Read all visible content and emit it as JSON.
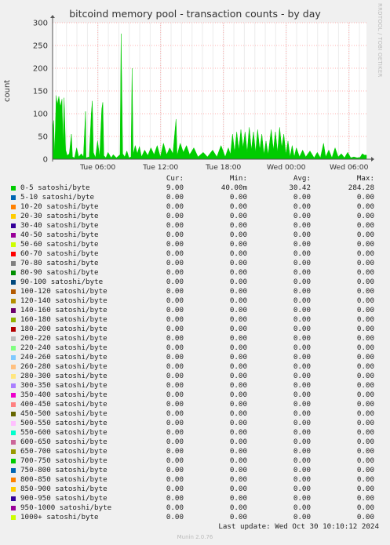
{
  "title": "bitcoind memory pool - transaction counts - by day",
  "side_label": "RRDTOOL / TOBI OETIKER",
  "footer": {
    "last_update": "Last update: Wed Oct 30 10:10:12 2024",
    "version": "Munin 2.0.76"
  },
  "colors": {
    "background": "#f0f0f0",
    "plot_background": "#ffffff",
    "grid": "#ff9999",
    "series_fill": "#00cc00"
  },
  "legend_headers": {
    "cur": "Cur:",
    "min": "Min:",
    "avg": "Avg:",
    "max": "Max:"
  },
  "legend": [
    {
      "name": "0-5 satoshi/byte",
      "color": "#00cc00",
      "cur": "9.00",
      "min": "40.00m",
      "avg": "30.42",
      "max": "284.28"
    },
    {
      "name": "5-10 satoshi/byte",
      "color": "#0066b3",
      "cur": "0.00",
      "min": "0.00",
      "avg": "0.00",
      "max": "0.00"
    },
    {
      "name": "10-20 satoshi/byte",
      "color": "#ff8000",
      "cur": "0.00",
      "min": "0.00",
      "avg": "0.00",
      "max": "0.00"
    },
    {
      "name": "20-30 satoshi/byte",
      "color": "#ffcc00",
      "cur": "0.00",
      "min": "0.00",
      "avg": "0.00",
      "max": "0.00"
    },
    {
      "name": "30-40 satoshi/byte",
      "color": "#330099",
      "cur": "0.00",
      "min": "0.00",
      "avg": "0.00",
      "max": "0.00"
    },
    {
      "name": "40-50 satoshi/byte",
      "color": "#990099",
      "cur": "0.00",
      "min": "0.00",
      "avg": "0.00",
      "max": "0.00"
    },
    {
      "name": "50-60 satoshi/byte",
      "color": "#ccff00",
      "cur": "0.00",
      "min": "0.00",
      "avg": "0.00",
      "max": "0.00"
    },
    {
      "name": "60-70 satoshi/byte",
      "color": "#ff0000",
      "cur": "0.00",
      "min": "0.00",
      "avg": "0.00",
      "max": "0.00"
    },
    {
      "name": "70-80 satoshi/byte",
      "color": "#808080",
      "cur": "0.00",
      "min": "0.00",
      "avg": "0.00",
      "max": "0.00"
    },
    {
      "name": "80-90 satoshi/byte",
      "color": "#008f00",
      "cur": "0.00",
      "min": "0.00",
      "avg": "0.00",
      "max": "0.00"
    },
    {
      "name": "90-100 satoshi/byte",
      "color": "#00487d",
      "cur": "0.00",
      "min": "0.00",
      "avg": "0.00",
      "max": "0.00"
    },
    {
      "name": "100-120 satoshi/byte",
      "color": "#b35a00",
      "cur": "0.00",
      "min": "0.00",
      "avg": "0.00",
      "max": "0.00"
    },
    {
      "name": "120-140 satoshi/byte",
      "color": "#b38f00",
      "cur": "0.00",
      "min": "0.00",
      "avg": "0.00",
      "max": "0.00"
    },
    {
      "name": "140-160 satoshi/byte",
      "color": "#6b006b",
      "cur": "0.00",
      "min": "0.00",
      "avg": "0.00",
      "max": "0.00"
    },
    {
      "name": "160-180 satoshi/byte",
      "color": "#8fb300",
      "cur": "0.00",
      "min": "0.00",
      "avg": "0.00",
      "max": "0.00"
    },
    {
      "name": "180-200 satoshi/byte",
      "color": "#b30000",
      "cur": "0.00",
      "min": "0.00",
      "avg": "0.00",
      "max": "0.00"
    },
    {
      "name": "200-220 satoshi/byte",
      "color": "#bebebe",
      "cur": "0.00",
      "min": "0.00",
      "avg": "0.00",
      "max": "0.00"
    },
    {
      "name": "220-240 satoshi/byte",
      "color": "#80ff80",
      "cur": "0.00",
      "min": "0.00",
      "avg": "0.00",
      "max": "0.00"
    },
    {
      "name": "240-260 satoshi/byte",
      "color": "#80c9ff",
      "cur": "0.00",
      "min": "0.00",
      "avg": "0.00",
      "max": "0.00"
    },
    {
      "name": "260-280 satoshi/byte",
      "color": "#ffc080",
      "cur": "0.00",
      "min": "0.00",
      "avg": "0.00",
      "max": "0.00"
    },
    {
      "name": "280-300 satoshi/byte",
      "color": "#ffe680",
      "cur": "0.00",
      "min": "0.00",
      "avg": "0.00",
      "max": "0.00"
    },
    {
      "name": "300-350 satoshi/byte",
      "color": "#aa80ff",
      "cur": "0.00",
      "min": "0.00",
      "avg": "0.00",
      "max": "0.00"
    },
    {
      "name": "350-400 satoshi/byte",
      "color": "#ee00cc",
      "cur": "0.00",
      "min": "0.00",
      "avg": "0.00",
      "max": "0.00"
    },
    {
      "name": "400-450 satoshi/byte",
      "color": "#ff8080",
      "cur": "0.00",
      "min": "0.00",
      "avg": "0.00",
      "max": "0.00"
    },
    {
      "name": "450-500 satoshi/byte",
      "color": "#666600",
      "cur": "0.00",
      "min": "0.00",
      "avg": "0.00",
      "max": "0.00"
    },
    {
      "name": "500-550 satoshi/byte",
      "color": "#ffbfff",
      "cur": "0.00",
      "min": "0.00",
      "avg": "0.00",
      "max": "0.00"
    },
    {
      "name": "550-600 satoshi/byte",
      "color": "#00ffcc",
      "cur": "0.00",
      "min": "0.00",
      "avg": "0.00",
      "max": "0.00"
    },
    {
      "name": "600-650 satoshi/byte",
      "color": "#cc6699",
      "cur": "0.00",
      "min": "0.00",
      "avg": "0.00",
      "max": "0.00"
    },
    {
      "name": "650-700 satoshi/byte",
      "color": "#999900",
      "cur": "0.00",
      "min": "0.00",
      "avg": "0.00",
      "max": "0.00"
    },
    {
      "name": "700-750 satoshi/byte",
      "color": "#00cc00",
      "cur": "0.00",
      "min": "0.00",
      "avg": "0.00",
      "max": "0.00"
    },
    {
      "name": "750-800 satoshi/byte",
      "color": "#0066b3",
      "cur": "0.00",
      "min": "0.00",
      "avg": "0.00",
      "max": "0.00"
    },
    {
      "name": "800-850 satoshi/byte",
      "color": "#ff8000",
      "cur": "0.00",
      "min": "0.00",
      "avg": "0.00",
      "max": "0.00"
    },
    {
      "name": "850-900 satoshi/byte",
      "color": "#ffcc00",
      "cur": "0.00",
      "min": "0.00",
      "avg": "0.00",
      "max": "0.00"
    },
    {
      "name": "900-950 satoshi/byte",
      "color": "#330099",
      "cur": "0.00",
      "min": "0.00",
      "avg": "0.00",
      "max": "0.00"
    },
    {
      "name": "950-1000 satoshi/byte",
      "color": "#990099",
      "cur": "0.00",
      "min": "0.00",
      "avg": "0.00",
      "max": "0.00"
    },
    {
      "name": "1000+ satoshi/byte",
      "color": "#ccff00",
      "cur": "0.00",
      "min": "0.00",
      "avg": "0.00",
      "max": "0.00"
    }
  ],
  "chart_data": {
    "type": "area",
    "title": "bitcoind memory pool - transaction counts - by day",
    "ylabel": "count",
    "xlabel": "",
    "ylim": [
      0,
      300
    ],
    "yticks": [
      0,
      50,
      100,
      150,
      200,
      250,
      300
    ],
    "xlim": [
      0,
      30
    ],
    "x_unit": "hours since plot start",
    "xticks": [
      {
        "x": 4.33,
        "label": "Tue 06:00"
      },
      {
        "x": 10.33,
        "label": "Tue 12:00"
      },
      {
        "x": 16.33,
        "label": "Tue 18:00"
      },
      {
        "x": 22.33,
        "label": "Wed 00:00"
      },
      {
        "x": 28.33,
        "label": "Wed 06:00"
      }
    ],
    "grid": true,
    "series": [
      {
        "name": "0-5 satoshi/byte",
        "points": [
          [
            0,
            60
          ],
          [
            0.1,
            85
          ],
          [
            0.2,
            10
          ],
          [
            0.35,
            140
          ],
          [
            0.45,
            120
          ],
          [
            0.6,
            138
          ],
          [
            0.75,
            115
          ],
          [
            0.9,
            132
          ],
          [
            1.0,
            30
          ],
          [
            1.1,
            135
          ],
          [
            1.25,
            20
          ],
          [
            1.4,
            8
          ],
          [
            1.6,
            12
          ],
          [
            1.8,
            55
          ],
          [
            1.9,
            5
          ],
          [
            2.1,
            3
          ],
          [
            2.3,
            25
          ],
          [
            2.5,
            5
          ],
          [
            2.75,
            12
          ],
          [
            2.95,
            5
          ],
          [
            3.15,
            105
          ],
          [
            3.2,
            3
          ],
          [
            3.5,
            5
          ],
          [
            3.7,
            100
          ],
          [
            3.8,
            128
          ],
          [
            3.9,
            15
          ],
          [
            4.1,
            3
          ],
          [
            4.3,
            40
          ],
          [
            4.5,
            5
          ],
          [
            4.7,
            110
          ],
          [
            4.8,
            125
          ],
          [
            4.9,
            8
          ],
          [
            5.1,
            3
          ],
          [
            5.3,
            15
          ],
          [
            5.6,
            3
          ],
          [
            5.8,
            10
          ],
          [
            6.1,
            3
          ],
          [
            6.45,
            10
          ],
          [
            6.55,
            276
          ],
          [
            6.7,
            12
          ],
          [
            6.9,
            5
          ],
          [
            7.1,
            18
          ],
          [
            7.3,
            3
          ],
          [
            7.5,
            5
          ],
          [
            7.6,
            200
          ],
          [
            7.7,
            10
          ],
          [
            7.9,
            30
          ],
          [
            8.1,
            12
          ],
          [
            8.3,
            28
          ],
          [
            8.5,
            5
          ],
          [
            8.8,
            20
          ],
          [
            9.1,
            8
          ],
          [
            9.4,
            25
          ],
          [
            9.7,
            10
          ],
          [
            10.0,
            30
          ],
          [
            10.3,
            5
          ],
          [
            10.6,
            35
          ],
          [
            10.9,
            10
          ],
          [
            11.2,
            25
          ],
          [
            11.5,
            12
          ],
          [
            11.8,
            88
          ],
          [
            11.9,
            8
          ],
          [
            12.2,
            35
          ],
          [
            12.5,
            15
          ],
          [
            12.8,
            30
          ],
          [
            13.1,
            10
          ],
          [
            13.5,
            25
          ],
          [
            13.9,
            5
          ],
          [
            14.4,
            15
          ],
          [
            14.8,
            5
          ],
          [
            15.3,
            20
          ],
          [
            15.7,
            5
          ],
          [
            16.1,
            30
          ],
          [
            16.5,
            5
          ],
          [
            16.8,
            25
          ],
          [
            17.0,
            10
          ],
          [
            17.2,
            55
          ],
          [
            17.4,
            15
          ],
          [
            17.6,
            60
          ],
          [
            17.8,
            20
          ],
          [
            18.0,
            65
          ],
          [
            18.2,
            25
          ],
          [
            18.4,
            60
          ],
          [
            18.6,
            15
          ],
          [
            18.8,
            70
          ],
          [
            19.0,
            20
          ],
          [
            19.2,
            60
          ],
          [
            19.4,
            15
          ],
          [
            19.6,
            65
          ],
          [
            19.8,
            20
          ],
          [
            20.0,
            55
          ],
          [
            20.2,
            10
          ],
          [
            20.4,
            40
          ],
          [
            20.6,
            10
          ],
          [
            20.9,
            65
          ],
          [
            21.1,
            20
          ],
          [
            21.3,
            60
          ],
          [
            21.5,
            15
          ],
          [
            21.7,
            70
          ],
          [
            21.9,
            25
          ],
          [
            22.1,
            55
          ],
          [
            22.3,
            10
          ],
          [
            22.5,
            40
          ],
          [
            22.7,
            5
          ],
          [
            22.9,
            30
          ],
          [
            23.1,
            5
          ],
          [
            23.3,
            25
          ],
          [
            23.6,
            5
          ],
          [
            23.9,
            20
          ],
          [
            24.2,
            5
          ],
          [
            24.6,
            18
          ],
          [
            25.0,
            3
          ],
          [
            25.3,
            15
          ],
          [
            25.6,
            3
          ],
          [
            25.9,
            35
          ],
          [
            26.1,
            5
          ],
          [
            26.4,
            20
          ],
          [
            26.7,
            3
          ],
          [
            27.0,
            25
          ],
          [
            27.3,
            5
          ],
          [
            27.6,
            12
          ],
          [
            27.9,
            3
          ],
          [
            28.2,
            15
          ],
          [
            28.5,
            3
          ],
          [
            28.8,
            5
          ],
          [
            29.1,
            3
          ],
          [
            29.4,
            4
          ],
          [
            29.6,
            12
          ],
          [
            29.8,
            9
          ],
          [
            30,
            9
          ]
        ]
      }
    ]
  }
}
